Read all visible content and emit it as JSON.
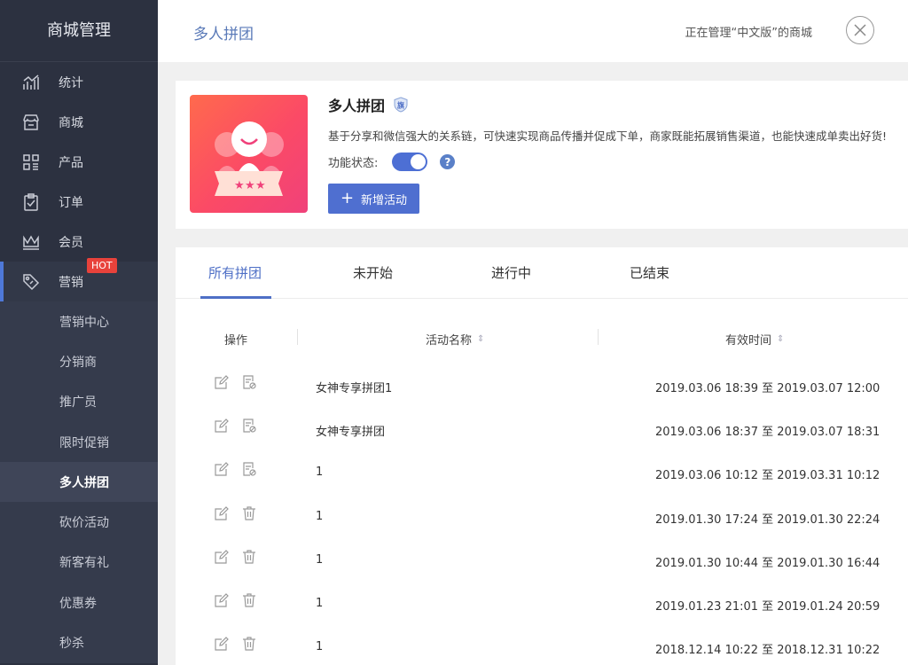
{
  "sidebar": {
    "title": "商城管理",
    "items": [
      {
        "label": "统计",
        "icon": "chart-icon"
      },
      {
        "label": "商城",
        "icon": "store-icon"
      },
      {
        "label": "产品",
        "icon": "grid-icon"
      },
      {
        "label": "订单",
        "icon": "clipboard-icon"
      },
      {
        "label": "会员",
        "icon": "crown-icon"
      },
      {
        "label": "营销",
        "icon": "tag-icon",
        "badge": "HOT"
      }
    ],
    "sub_items": [
      {
        "label": "营销中心"
      },
      {
        "label": "分销商"
      },
      {
        "label": "推广员"
      },
      {
        "label": "限时促销"
      },
      {
        "label": "多人拼团"
      },
      {
        "label": "砍价活动"
      },
      {
        "label": "新客有礼"
      },
      {
        "label": "优惠券"
      },
      {
        "label": "秒杀"
      }
    ]
  },
  "header": {
    "title": "多人拼团",
    "manage_text": "正在管理“中文版”的商城"
  },
  "intro": {
    "title": "多人拼团",
    "badge_text": "旗",
    "description": "基于分享和微信强大的关系链，可快速实现商品传播并促成下单，商家既能拓展销售渠道，也能快速成单卖出好货!",
    "status_label": "功能状态:",
    "status_on": true,
    "add_button": "新增活动"
  },
  "tabs": [
    {
      "label": "所有拼团",
      "active": true
    },
    {
      "label": "未开始",
      "active": false
    },
    {
      "label": "进行中",
      "active": false
    },
    {
      "label": "已结束",
      "active": false
    }
  ],
  "table": {
    "columns": [
      "操作",
      "活动名称",
      "有效时间"
    ],
    "rows": [
      {
        "name": "女神专享拼团1",
        "time": "2019.03.06 18:39 至 2019.03.07 12:00",
        "action2": "stop"
      },
      {
        "name": "女神专享拼团",
        "time": "2019.03.06 18:37 至 2019.03.07 18:31",
        "action2": "stop"
      },
      {
        "name": "1",
        "time": "2019.03.06 10:12 至 2019.03.31 10:12",
        "action2": "stop"
      },
      {
        "name": "1",
        "time": "2019.01.30 17:24 至 2019.01.30 22:24",
        "action2": "delete"
      },
      {
        "name": "1",
        "time": "2019.01.30 10:44 至 2019.01.30 16:44",
        "action2": "delete"
      },
      {
        "name": "1",
        "time": "2019.01.23 21:01 至 2019.01.24 20:59",
        "action2": "delete"
      },
      {
        "name": "1",
        "time": "2018.12.14 10:22 至 2018.12.31 10:22",
        "action2": "delete"
      }
    ]
  },
  "colors": {
    "sidebar_bg": "#2c3140",
    "accent": "#4e6fc6",
    "hot_badge": "#e8423b",
    "banner_gradient_start": "#ff6a4d",
    "banner_gradient_end": "#f0417a"
  }
}
